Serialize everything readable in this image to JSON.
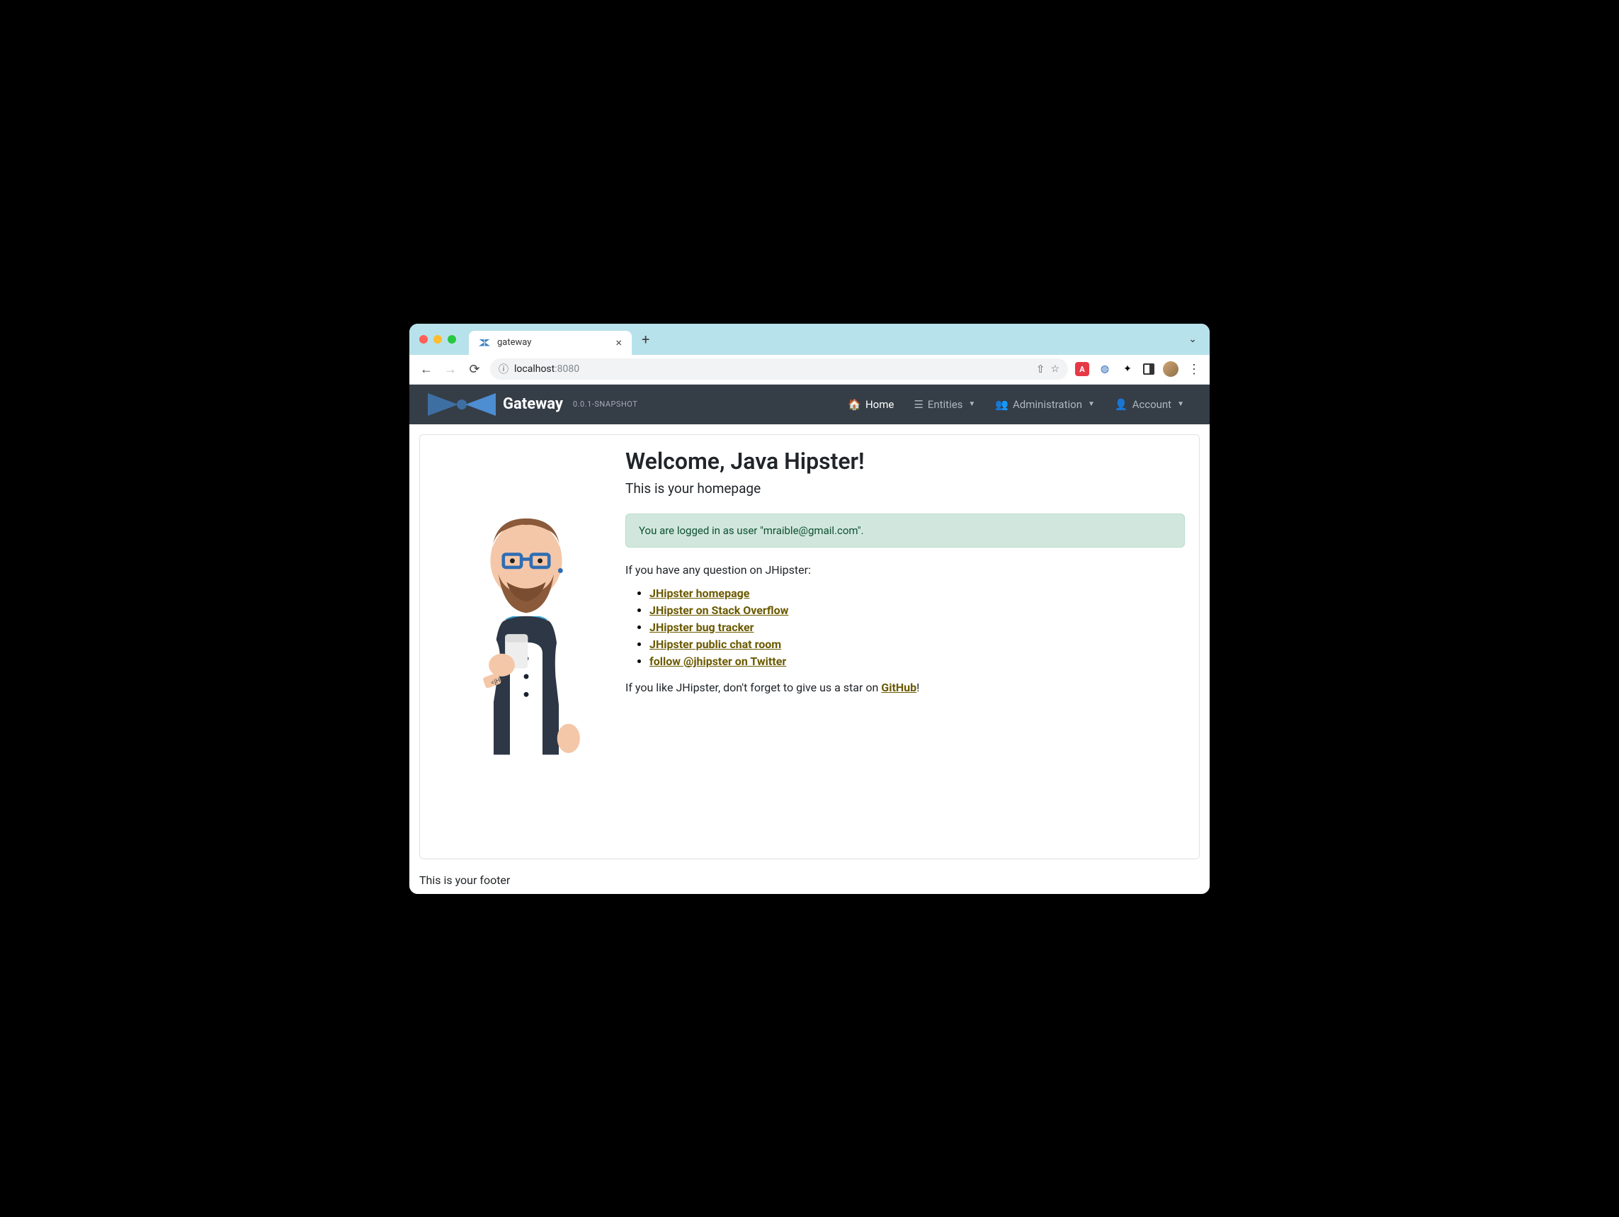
{
  "browser": {
    "tab_title": "gateway",
    "url_host": "localhost",
    "url_port": ":8080"
  },
  "navbar": {
    "brand": "Gateway",
    "version": "0.0.1-SNAPSHOT",
    "items": {
      "home": "Home",
      "entities": "Entities",
      "administration": "Administration",
      "account": "Account"
    }
  },
  "page": {
    "heading": "Welcome, Java Hipster!",
    "lead": "This is your homepage",
    "alert_prefix": "You are logged in as user \"",
    "alert_user": "mraible@gmail.com",
    "alert_suffix": "\".",
    "question": "If you have any question on JHipster:",
    "links": [
      "JHipster homepage",
      "JHipster on Stack Overflow",
      "JHipster bug tracker",
      "JHipster public chat room",
      "follow @jhipster on Twitter"
    ],
    "star_prefix": "If you like JHipster, don't forget to give us a star on ",
    "star_link": "GitHub",
    "star_suffix": "!"
  },
  "footer": "This is your footer"
}
